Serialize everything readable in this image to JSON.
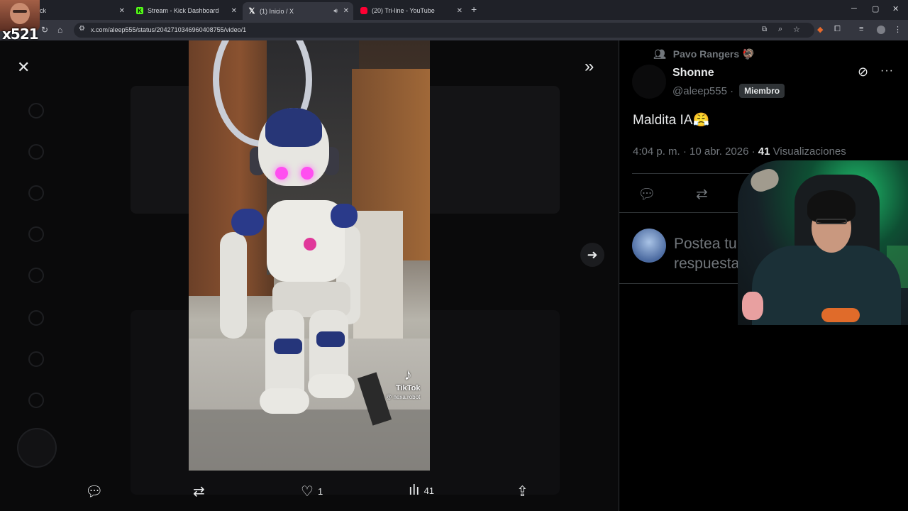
{
  "browser": {
    "tabs": [
      {
        "title": "ck",
        "favicon": "kick"
      },
      {
        "title": "Stream - Kick Dashboard",
        "favicon": "kick"
      },
      {
        "title": "(1) Inicio / X",
        "favicon": "x",
        "active": true,
        "audio": true
      },
      {
        "title": "(20) Tri-line - YouTube",
        "favicon": "youtube"
      }
    ],
    "url": "x.com/aleep555/status/2042710346960408755/video/1",
    "window_controls": [
      "minimize",
      "maximize",
      "close"
    ]
  },
  "overlay": {
    "badge": "x521"
  },
  "video": {
    "watermark_brand": "TikTok",
    "watermark_user": "@ nexa.robot"
  },
  "actions": {
    "reply_count": "",
    "retweet_count": "",
    "like_count": "1",
    "views_count": "41"
  },
  "post": {
    "community": "Pavo Rangers 🦃",
    "author_name": "Shonne",
    "author_handle": "@aleep555 ·",
    "member_badge": "Miembro",
    "text": "Maldita IA😤",
    "time": "4:04 p. m. · 10 abr. 2026 ·",
    "views": "41",
    "views_label": "Visualizaciones",
    "reply_placeholder": "Postea tu respuesta"
  },
  "colors": {
    "background": "#000000",
    "muted_text": "#71767b",
    "primary_text": "#e7e9ea",
    "border": "#2f3336"
  }
}
